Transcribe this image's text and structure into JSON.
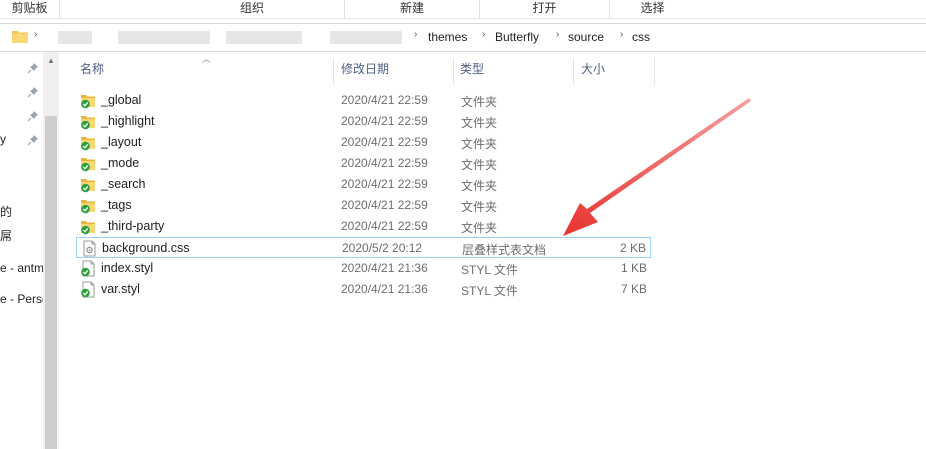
{
  "ribbon": {
    "groups": [
      "剪贴板",
      "组织",
      "新建",
      "打开",
      "选择"
    ]
  },
  "address": {
    "crumbs": [
      "themes",
      "Butterfly",
      "source",
      "css"
    ]
  },
  "nav": {
    "items": [
      "y",
      "的",
      "屌",
      "e - antm",
      "e - Perso"
    ]
  },
  "columns": {
    "name": "名称",
    "date": "修改日期",
    "type": "类型",
    "size": "大小"
  },
  "files": [
    {
      "name": "_global",
      "date": "2020/4/21 22:59",
      "type": "文件夹",
      "size": "",
      "kind": "folder"
    },
    {
      "name": "_highlight",
      "date": "2020/4/21 22:59",
      "type": "文件夹",
      "size": "",
      "kind": "folder"
    },
    {
      "name": "_layout",
      "date": "2020/4/21 22:59",
      "type": "文件夹",
      "size": "",
      "kind": "folder"
    },
    {
      "name": "_mode",
      "date": "2020/4/21 22:59",
      "type": "文件夹",
      "size": "",
      "kind": "folder"
    },
    {
      "name": "_search",
      "date": "2020/4/21 22:59",
      "type": "文件夹",
      "size": "",
      "kind": "folder"
    },
    {
      "name": "_tags",
      "date": "2020/4/21 22:59",
      "type": "文件夹",
      "size": "",
      "kind": "folder"
    },
    {
      "name": "_third-party",
      "date": "2020/4/21 22:59",
      "type": "文件夹",
      "size": "",
      "kind": "folder"
    },
    {
      "name": "background.css",
      "date": "2020/5/2 20:12",
      "type": "层叠样式表文档",
      "size": "2 KB",
      "kind": "css"
    },
    {
      "name": "index.styl",
      "date": "2020/4/21 21:36",
      "type": "STYL 文件",
      "size": "1 KB",
      "kind": "styl"
    },
    {
      "name": "var.styl",
      "date": "2020/4/21 21:36",
      "type": "STYL 文件",
      "size": "7 KB",
      "kind": "styl"
    }
  ],
  "icons": {
    "folder": "folder-synced-icon",
    "css": "css-file-icon",
    "styl": "styl-file-synced-icon",
    "pin": "pin-icon"
  },
  "colors": {
    "annotation_arrow": "#e8322f",
    "sync_badge": "#2e9e3a",
    "folder": "#f3c64a",
    "selection_border": "#99d1ff"
  }
}
